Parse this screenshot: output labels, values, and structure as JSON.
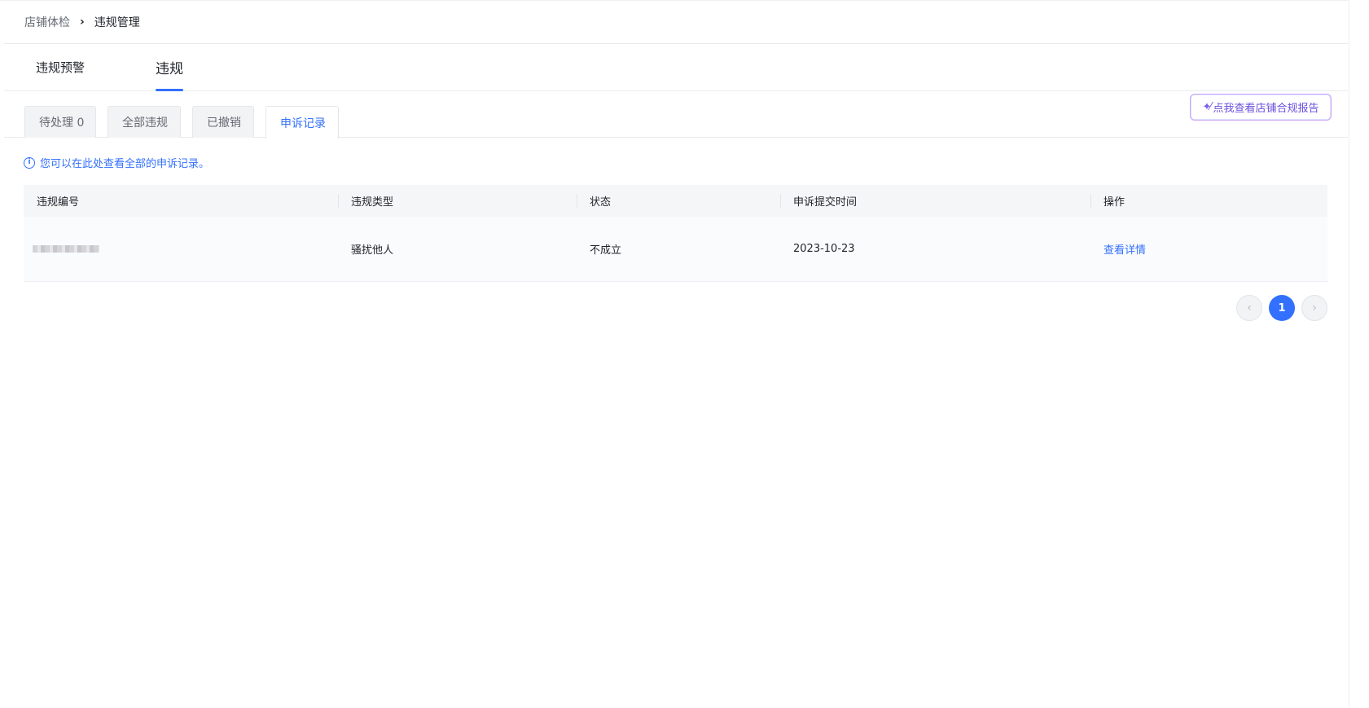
{
  "breadcrumb": {
    "parent": "店铺体检",
    "separator": "›",
    "current": "违规管理"
  },
  "main_tabs": [
    {
      "label": "违规预警"
    },
    {
      "label": "违规",
      "active": true
    }
  ],
  "sub_tabs": [
    {
      "label": "待处理 0"
    },
    {
      "label": "全部违规"
    },
    {
      "label": "已撤销"
    },
    {
      "label": "申诉记录",
      "active": true
    }
  ],
  "report_button": {
    "icon": "sparkle-wand-icon",
    "label": "点我查看店铺合规报告"
  },
  "notice": {
    "icon": "info-icon",
    "text": "您可以在此处查看全部的申诉记录。"
  },
  "table": {
    "headers": [
      "违规编号",
      "违规类型",
      "状态",
      "申诉提交时间",
      "操作"
    ],
    "rows": [
      {
        "id": "",
        "type": "骚扰他人",
        "status": "不成立",
        "submit_time": "2023-10-23",
        "action": "查看详情"
      }
    ]
  },
  "pagination": {
    "prev": "‹",
    "current_page": "1",
    "next": "›"
  },
  "colors": {
    "accent": "#3370ff",
    "report_text": "#6b4fdc",
    "text_primary": "#1f2329",
    "text_secondary": "#646a73"
  }
}
